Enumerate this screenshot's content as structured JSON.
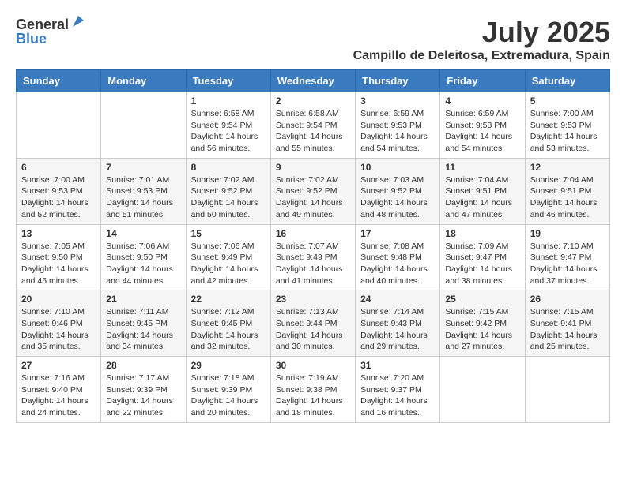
{
  "header": {
    "logo": {
      "general": "General",
      "blue": "Blue"
    },
    "title": "July 2025",
    "location": "Campillo de Deleitosa, Extremadura, Spain"
  },
  "calendar": {
    "days_of_week": [
      "Sunday",
      "Monday",
      "Tuesday",
      "Wednesday",
      "Thursday",
      "Friday",
      "Saturday"
    ],
    "weeks": [
      [
        {
          "day": "",
          "info": ""
        },
        {
          "day": "",
          "info": ""
        },
        {
          "day": "1",
          "info": "Sunrise: 6:58 AM\nSunset: 9:54 PM\nDaylight: 14 hours and 56 minutes."
        },
        {
          "day": "2",
          "info": "Sunrise: 6:58 AM\nSunset: 9:54 PM\nDaylight: 14 hours and 55 minutes."
        },
        {
          "day": "3",
          "info": "Sunrise: 6:59 AM\nSunset: 9:53 PM\nDaylight: 14 hours and 54 minutes."
        },
        {
          "day": "4",
          "info": "Sunrise: 6:59 AM\nSunset: 9:53 PM\nDaylight: 14 hours and 54 minutes."
        },
        {
          "day": "5",
          "info": "Sunrise: 7:00 AM\nSunset: 9:53 PM\nDaylight: 14 hours and 53 minutes."
        }
      ],
      [
        {
          "day": "6",
          "info": "Sunrise: 7:00 AM\nSunset: 9:53 PM\nDaylight: 14 hours and 52 minutes."
        },
        {
          "day": "7",
          "info": "Sunrise: 7:01 AM\nSunset: 9:53 PM\nDaylight: 14 hours and 51 minutes."
        },
        {
          "day": "8",
          "info": "Sunrise: 7:02 AM\nSunset: 9:52 PM\nDaylight: 14 hours and 50 minutes."
        },
        {
          "day": "9",
          "info": "Sunrise: 7:02 AM\nSunset: 9:52 PM\nDaylight: 14 hours and 49 minutes."
        },
        {
          "day": "10",
          "info": "Sunrise: 7:03 AM\nSunset: 9:52 PM\nDaylight: 14 hours and 48 minutes."
        },
        {
          "day": "11",
          "info": "Sunrise: 7:04 AM\nSunset: 9:51 PM\nDaylight: 14 hours and 47 minutes."
        },
        {
          "day": "12",
          "info": "Sunrise: 7:04 AM\nSunset: 9:51 PM\nDaylight: 14 hours and 46 minutes."
        }
      ],
      [
        {
          "day": "13",
          "info": "Sunrise: 7:05 AM\nSunset: 9:50 PM\nDaylight: 14 hours and 45 minutes."
        },
        {
          "day": "14",
          "info": "Sunrise: 7:06 AM\nSunset: 9:50 PM\nDaylight: 14 hours and 44 minutes."
        },
        {
          "day": "15",
          "info": "Sunrise: 7:06 AM\nSunset: 9:49 PM\nDaylight: 14 hours and 42 minutes."
        },
        {
          "day": "16",
          "info": "Sunrise: 7:07 AM\nSunset: 9:49 PM\nDaylight: 14 hours and 41 minutes."
        },
        {
          "day": "17",
          "info": "Sunrise: 7:08 AM\nSunset: 9:48 PM\nDaylight: 14 hours and 40 minutes."
        },
        {
          "day": "18",
          "info": "Sunrise: 7:09 AM\nSunset: 9:47 PM\nDaylight: 14 hours and 38 minutes."
        },
        {
          "day": "19",
          "info": "Sunrise: 7:10 AM\nSunset: 9:47 PM\nDaylight: 14 hours and 37 minutes."
        }
      ],
      [
        {
          "day": "20",
          "info": "Sunrise: 7:10 AM\nSunset: 9:46 PM\nDaylight: 14 hours and 35 minutes."
        },
        {
          "day": "21",
          "info": "Sunrise: 7:11 AM\nSunset: 9:45 PM\nDaylight: 14 hours and 34 minutes."
        },
        {
          "day": "22",
          "info": "Sunrise: 7:12 AM\nSunset: 9:45 PM\nDaylight: 14 hours and 32 minutes."
        },
        {
          "day": "23",
          "info": "Sunrise: 7:13 AM\nSunset: 9:44 PM\nDaylight: 14 hours and 30 minutes."
        },
        {
          "day": "24",
          "info": "Sunrise: 7:14 AM\nSunset: 9:43 PM\nDaylight: 14 hours and 29 minutes."
        },
        {
          "day": "25",
          "info": "Sunrise: 7:15 AM\nSunset: 9:42 PM\nDaylight: 14 hours and 27 minutes."
        },
        {
          "day": "26",
          "info": "Sunrise: 7:15 AM\nSunset: 9:41 PM\nDaylight: 14 hours and 25 minutes."
        }
      ],
      [
        {
          "day": "27",
          "info": "Sunrise: 7:16 AM\nSunset: 9:40 PM\nDaylight: 14 hours and 24 minutes."
        },
        {
          "day": "28",
          "info": "Sunrise: 7:17 AM\nSunset: 9:39 PM\nDaylight: 14 hours and 22 minutes."
        },
        {
          "day": "29",
          "info": "Sunrise: 7:18 AM\nSunset: 9:39 PM\nDaylight: 14 hours and 20 minutes."
        },
        {
          "day": "30",
          "info": "Sunrise: 7:19 AM\nSunset: 9:38 PM\nDaylight: 14 hours and 18 minutes."
        },
        {
          "day": "31",
          "info": "Sunrise: 7:20 AM\nSunset: 9:37 PM\nDaylight: 14 hours and 16 minutes."
        },
        {
          "day": "",
          "info": ""
        },
        {
          "day": "",
          "info": ""
        }
      ]
    ]
  }
}
